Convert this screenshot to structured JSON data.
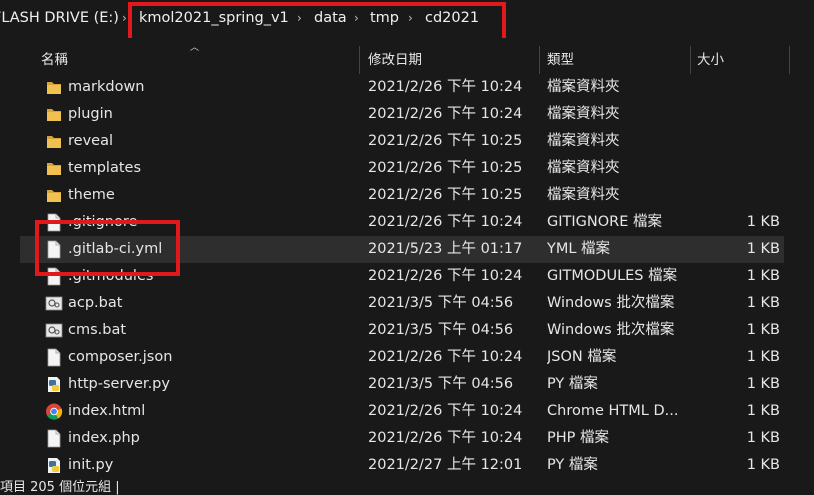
{
  "breadcrumb": {
    "drive": "FLASH DRIVE (E:)",
    "items": [
      "kmol2021_spring_v1",
      "data",
      "tmp",
      "cd2021"
    ]
  },
  "columns": {
    "name": "名稱",
    "date": "修改日期",
    "type": "類型",
    "size": "大小"
  },
  "files": [
    {
      "name": "markdown",
      "date": "2021/2/26 下午 10:24",
      "type": "檔案資料夾",
      "size": "",
      "icon": "folder-icon"
    },
    {
      "name": "plugin",
      "date": "2021/2/26 下午 10:24",
      "type": "檔案資料夾",
      "size": "",
      "icon": "folder-icon"
    },
    {
      "name": "reveal",
      "date": "2021/2/26 下午 10:25",
      "type": "檔案資料夾",
      "size": "",
      "icon": "folder-icon"
    },
    {
      "name": "templates",
      "date": "2021/2/26 下午 10:25",
      "type": "檔案資料夾",
      "size": "",
      "icon": "folder-icon"
    },
    {
      "name": "theme",
      "date": "2021/2/26 下午 10:25",
      "type": "檔案資料夾",
      "size": "",
      "icon": "folder-icon"
    },
    {
      "name": ".gitignore",
      "date": "2021/2/26 下午 10:24",
      "type": "GITIGNORE 檔案",
      "size": "1 KB",
      "icon": "file-icon"
    },
    {
      "name": ".gitlab-ci.yml",
      "date": "2021/5/23 上午 01:17",
      "type": "YML 檔案",
      "size": "1 KB",
      "icon": "file-icon",
      "selected": true
    },
    {
      "name": ".gitmodules",
      "date": "2021/2/26 下午 10:24",
      "type": "GITMODULES 檔案",
      "size": "1 KB",
      "icon": "file-icon"
    },
    {
      "name": "acp.bat",
      "date": "2021/3/5 下午 04:56",
      "type": "Windows 批次檔案",
      "size": "1 KB",
      "icon": "batch-file-icon"
    },
    {
      "name": "cms.bat",
      "date": "2021/3/5 下午 04:56",
      "type": "Windows 批次檔案",
      "size": "1 KB",
      "icon": "batch-file-icon"
    },
    {
      "name": "composer.json",
      "date": "2021/2/26 下午 10:24",
      "type": "JSON 檔案",
      "size": "1 KB",
      "icon": "file-icon"
    },
    {
      "name": "http-server.py",
      "date": "2021/3/5 下午 04:56",
      "type": "PY 檔案",
      "size": "1 KB",
      "icon": "python-file-icon"
    },
    {
      "name": "index.html",
      "date": "2021/2/26 下午 10:24",
      "type": "Chrome HTML D...",
      "size": "1 KB",
      "icon": "chrome-icon"
    },
    {
      "name": "index.php",
      "date": "2021/2/26 下午 10:24",
      "type": "PHP 檔案",
      "size": "1 KB",
      "icon": "file-icon"
    },
    {
      "name": "init.py",
      "date": "2021/2/27 上午 12:01",
      "type": "PY 檔案",
      "size": "1 KB",
      "icon": "python-file-icon"
    }
  ],
  "status": {
    "text": "項目  205 個位元組  |"
  },
  "colors": {
    "background": "#191919",
    "selected_row": "#2e2e2e",
    "folder": "#e8b84a",
    "highlight": "#e2191c"
  }
}
